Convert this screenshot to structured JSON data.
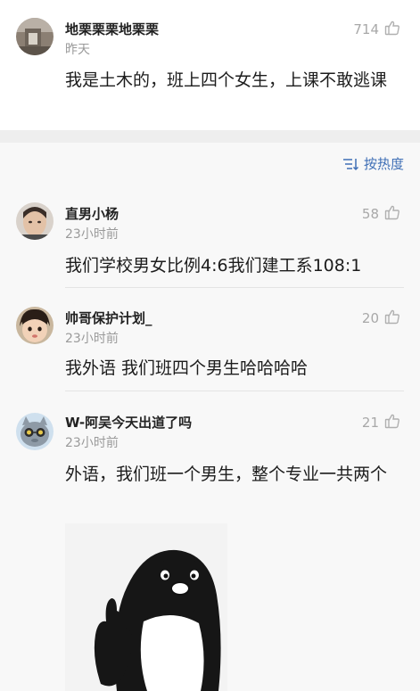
{
  "pinned": {
    "author": "地栗栗栗地栗栗",
    "time": "昨天",
    "likes": "714",
    "content": "我是土木的，班上四个女生，上课不敢逃课"
  },
  "sort": {
    "label": "按热度"
  },
  "comments": [
    {
      "author": "直男小杨",
      "time": "23小时前",
      "likes": "58",
      "content": "我们学校男女比例4:6我们建工系108:1"
    },
    {
      "author": "帅哥保护计划_",
      "time": "23小时前",
      "likes": "20",
      "content": "我外语 我们班四个男生哈哈哈哈"
    },
    {
      "author": "W-阿吴今天出道了吗",
      "time": "23小时前",
      "likes": "21",
      "content": "外语，我们班一个男生，整个专业一共两个"
    }
  ],
  "colors": {
    "accent": "#3f6fb6",
    "gap": "#eeeeee",
    "list_bg": "#f8f8f8",
    "muted": "#9a9a9a"
  },
  "icons": {
    "like": "thumbs-up-icon",
    "sort": "sort-by-heat-icon"
  }
}
